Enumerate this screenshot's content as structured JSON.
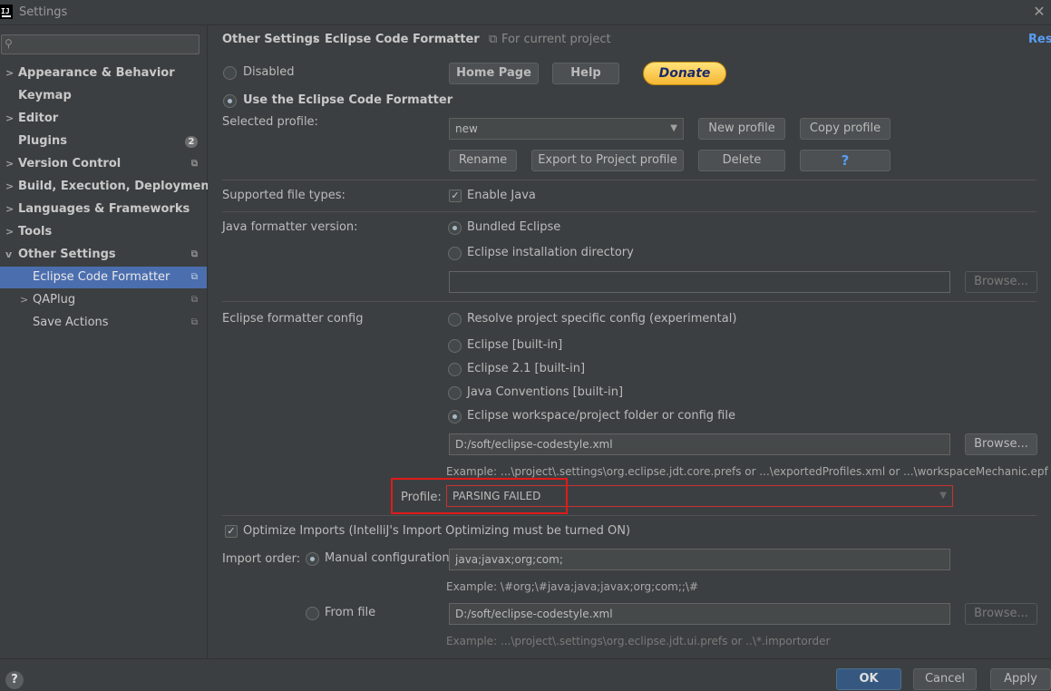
{
  "window": {
    "title": "Settings",
    "app_icon": "intellij-logo-icon",
    "close_icon": "close-icon"
  },
  "search": {
    "placeholder": "",
    "icon": "search-icon"
  },
  "sidebar": {
    "items": [
      {
        "label": "Appearance & Behavior",
        "expandable": true
      },
      {
        "label": "Keymap"
      },
      {
        "label": "Editor",
        "expandable": true
      },
      {
        "label": "Plugins",
        "badge": "2"
      },
      {
        "label": "Version Control",
        "expandable": true
      },
      {
        "label": "Build, Execution, Deployment",
        "expandable": true
      },
      {
        "label": "Languages & Frameworks",
        "expandable": true
      },
      {
        "label": "Tools",
        "expandable": true
      },
      {
        "label": "Other Settings",
        "expanded": true
      },
      {
        "label": "Eclipse Code Formatter",
        "selected": true
      },
      {
        "label": "QAPlug",
        "expandable": true
      },
      {
        "label": "Save Actions"
      }
    ]
  },
  "header": {
    "breadcrumb_parent": "Other Settings",
    "breadcrumb_sep": "›",
    "breadcrumb_current": "Eclipse Code Formatter",
    "scope_note": "For current project",
    "reset_link": "Reset"
  },
  "formatter": {
    "disabled_label": "Disabled",
    "use_eclipse_label": "Use the Eclipse Code Formatter",
    "home_page_btn": "Home Page",
    "help_btn": "Help",
    "donate_btn": "Donate",
    "selected_profile_label": "Selected profile:",
    "selected_profile_value": "new",
    "new_profile_btn": "New profile",
    "copy_profile_btn": "Copy profile",
    "rename_btn": "Rename",
    "export_btn": "Export to Project profile",
    "delete_btn": "Delete",
    "question_btn": "?"
  },
  "file_types": {
    "label": "Supported file types:",
    "enable_java": "Enable Java",
    "enable_java_checked": true
  },
  "java_version": {
    "label": "Java formatter version:",
    "bundled": "Bundled Eclipse",
    "install_dir": "Eclipse installation directory",
    "install_path": "",
    "browse_btn": "Browse..."
  },
  "config": {
    "label": "Eclipse formatter config",
    "options": [
      "Resolve project specific config (experimental)",
      "Eclipse [built-in]",
      "Eclipse 2.1 [built-in]",
      "Java Conventions [built-in]",
      "Eclipse workspace/project folder or config file"
    ],
    "selected_option": 4,
    "path": "D:/soft/eclipse-codestyle.xml",
    "browse_btn": "Browse...",
    "example": "Example: ...\\project\\.settings\\org.eclipse.jdt.core.prefs or ...\\exportedProfiles.xml or ...\\workspaceMechanic.epf",
    "profile_label": "Profile:",
    "profile_value": "PARSING FAILED"
  },
  "imports": {
    "optimize_label": "Optimize Imports  (IntelliJ's Import Optimizing must be turned ON)",
    "optimize_checked": true,
    "order_label": "Import order:",
    "manual_label": "Manual configuration",
    "manual_value": "java;javax;org;com;",
    "manual_example": "Example: \\#org;\\#java;java;javax;org;com;;\\#",
    "from_file_label": "From file",
    "from_file_value": "D:/soft/eclipse-codestyle.xml",
    "browse_btn": "Browse...",
    "from_file_example": "Example: ...\\project\\.settings\\org.eclipse.jdt.ui.prefs or ..\\*.importorder"
  },
  "footer": {
    "help": "?",
    "ok": "OK",
    "cancel": "Cancel",
    "apply": "Apply"
  },
  "colors": {
    "accent": "#4b6eaf",
    "link": "#589df6",
    "error": "#c83232",
    "annotation": "#e11a1a",
    "donate": "#f7b733"
  }
}
